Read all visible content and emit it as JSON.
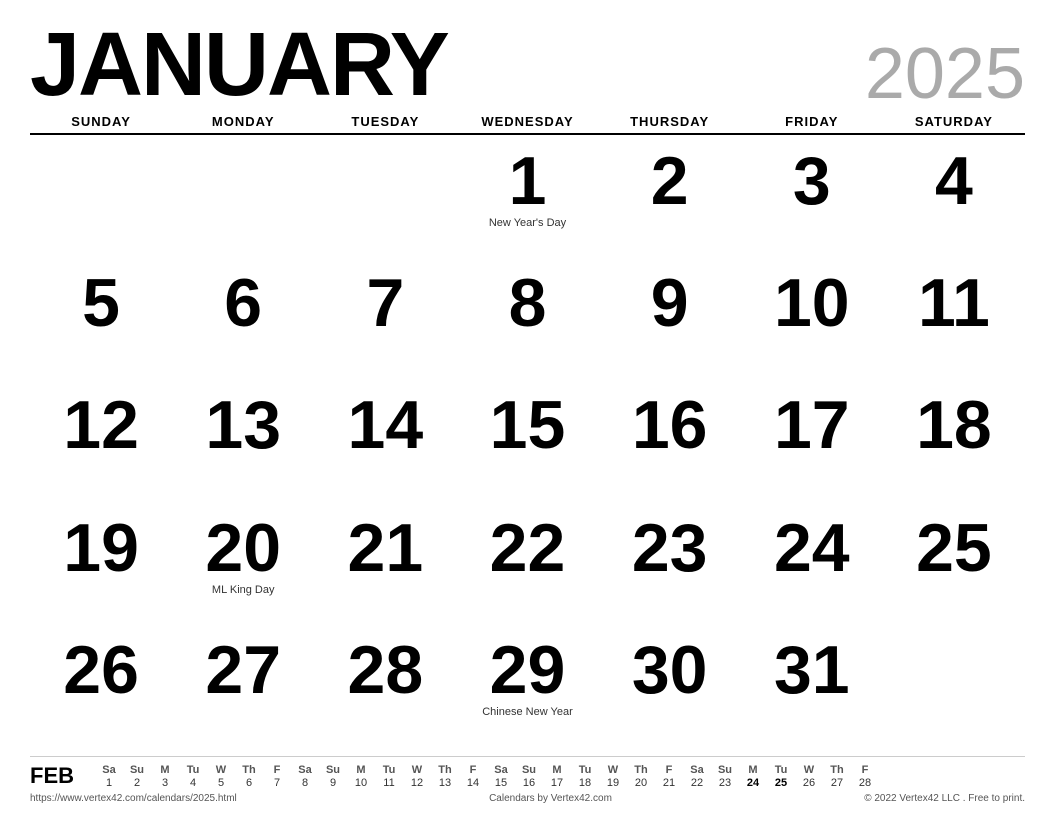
{
  "header": {
    "month": "JANUARY",
    "year": "2025"
  },
  "day_headers": [
    "SUNDAY",
    "MONDAY",
    "TUESDAY",
    "WEDNESDAY",
    "THURSDAY",
    "FRIDAY",
    "SATURDAY"
  ],
  "weeks": [
    [
      {
        "day": "",
        "event": ""
      },
      {
        "day": "",
        "event": ""
      },
      {
        "day": "",
        "event": ""
      },
      {
        "day": "1",
        "event": "New Year's Day"
      },
      {
        "day": "2",
        "event": ""
      },
      {
        "day": "3",
        "event": ""
      },
      {
        "day": "4",
        "event": ""
      }
    ],
    [
      {
        "day": "5",
        "event": ""
      },
      {
        "day": "6",
        "event": ""
      },
      {
        "day": "7",
        "event": ""
      },
      {
        "day": "8",
        "event": ""
      },
      {
        "day": "9",
        "event": ""
      },
      {
        "day": "10",
        "event": ""
      },
      {
        "day": "11",
        "event": ""
      }
    ],
    [
      {
        "day": "12",
        "event": ""
      },
      {
        "day": "13",
        "event": ""
      },
      {
        "day": "14",
        "event": ""
      },
      {
        "day": "15",
        "event": ""
      },
      {
        "day": "16",
        "event": ""
      },
      {
        "day": "17",
        "event": ""
      },
      {
        "day": "18",
        "event": ""
      }
    ],
    [
      {
        "day": "19",
        "event": ""
      },
      {
        "day": "20",
        "event": "ML King Day"
      },
      {
        "day": "21",
        "event": ""
      },
      {
        "day": "22",
        "event": ""
      },
      {
        "day": "23",
        "event": ""
      },
      {
        "day": "24",
        "event": ""
      },
      {
        "day": "25",
        "event": ""
      }
    ],
    [
      {
        "day": "26",
        "event": ""
      },
      {
        "day": "27",
        "event": ""
      },
      {
        "day": "28",
        "event": ""
      },
      {
        "day": "29",
        "event": "Chinese New Year"
      },
      {
        "day": "30",
        "event": ""
      },
      {
        "day": "31",
        "event": ""
      },
      {
        "day": "",
        "event": ""
      }
    ]
  ],
  "mini": {
    "month_label": "FEB",
    "headers": [
      "Sa",
      "Su",
      "M",
      "Tu",
      "W",
      "Th",
      "F",
      "Sa",
      "Su",
      "M",
      "Tu",
      "W",
      "Th",
      "F",
      "Sa",
      "Su",
      "M",
      "Tu",
      "W",
      "Th",
      "F",
      "Sa",
      "Su",
      "M",
      "Tu",
      "W",
      "Th",
      "F"
    ],
    "days": [
      "1",
      "2",
      "3",
      "4",
      "5",
      "6",
      "7",
      "8",
      "9",
      "10",
      "11",
      "12",
      "13",
      "14",
      "15",
      "16",
      "17",
      "18",
      "19",
      "20",
      "21",
      "22",
      "23",
      "24",
      "25",
      "26",
      "27",
      "28"
    ],
    "bold_days": [
      "24",
      "25"
    ]
  },
  "footer": {
    "url": "https://www.vertex42.com/calendars/2025.html",
    "center": "Calendars by Vertex42.com",
    "right": "© 2022 Vertex42 LLC . Free to print."
  }
}
